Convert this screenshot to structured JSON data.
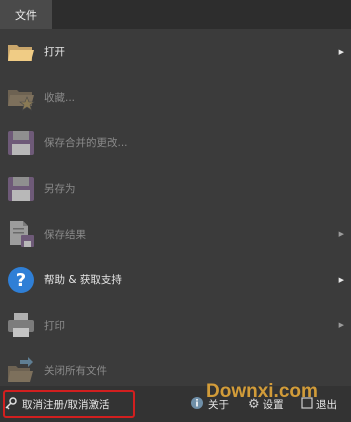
{
  "tab": {
    "label": "文件"
  },
  "menu": [
    {
      "label": "打开",
      "icon": "folder-open-icon",
      "disabled": false,
      "submenu": true
    },
    {
      "label": "收藏...",
      "icon": "folder-star-icon",
      "disabled": true,
      "submenu": false
    },
    {
      "label": "保存合并的更改...",
      "icon": "floppy-disk-icon",
      "disabled": true,
      "submenu": false
    },
    {
      "label": "另存为",
      "icon": "floppy-disk-icon",
      "disabled": true,
      "submenu": false
    },
    {
      "label": "保存结果",
      "icon": "document-save-icon",
      "disabled": true,
      "submenu": true
    },
    {
      "label": "帮助 & 获取支持",
      "icon": "help-icon",
      "disabled": false,
      "submenu": true
    },
    {
      "label": "打印",
      "icon": "printer-icon",
      "disabled": true,
      "submenu": true
    },
    {
      "label": "关闭所有文件",
      "icon": "close-files-icon",
      "disabled": true,
      "submenu": false
    }
  ],
  "bottom": {
    "deactivate": "取消注册/取消激活",
    "about": "关于",
    "settings": "设置",
    "exit": "退出"
  },
  "watermark": "Downxi.com",
  "colors": {
    "background": "#3b3b3b",
    "highlight_border": "#d21f1f",
    "help_blue": "#2f7fd6"
  }
}
